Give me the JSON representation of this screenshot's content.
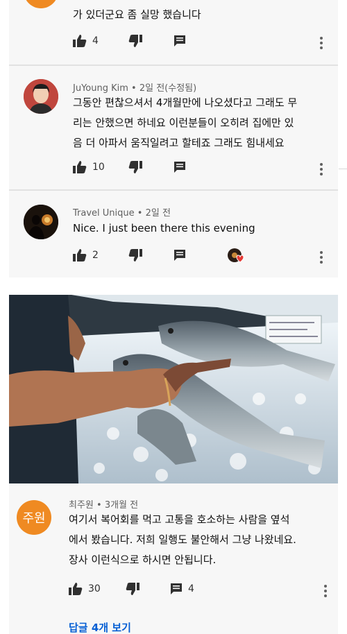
{
  "comments": [
    {
      "author": "",
      "time": "",
      "text_lines": [
        "가 있더군요 좀 실망 했습니다"
      ],
      "likes": "4",
      "replies": ""
    },
    {
      "author": "JuYoung Kim",
      "time": "2일 전(수정됨)",
      "text_lines": [
        "그동안 편찮으셔서 4개월만에 나오셨다고 그래도 무",
        "리는 안했으면 하네요 이런분들이 오히려 집에만 있",
        "음 더 아파서 움직일려고 할테죠 그래도 힘내세요"
      ],
      "likes": "10",
      "replies": ""
    },
    {
      "author": "Travel Unique",
      "time": "2일 전",
      "text_lines": [
        "Nice. I just been there this evening"
      ],
      "likes": "2",
      "replies": ""
    },
    {
      "author": "최주원",
      "avatar_text": "주원",
      "time": "3개월 전",
      "text_lines": [
        "여기서 복어회를 먹고 고통을 호소하는 사람을 옆석",
        "에서 봤습니다. 저희 일행도 불안해서 그냥 나왔네요.",
        "장사 이런식으로 하시면 안됩니다."
      ],
      "likes": "30",
      "replies": "4"
    }
  ],
  "view_replies": "답글 4개 보기",
  "colors": {
    "panel": "#f7f7f7",
    "link": "#065fd4",
    "avatar_orange": "#ef8a22",
    "meta": "#606060"
  },
  "icons": [
    "thumb-up-icon",
    "thumb-down-icon",
    "reply-icon",
    "more-vert-icon",
    "creator-heart-icon"
  ]
}
